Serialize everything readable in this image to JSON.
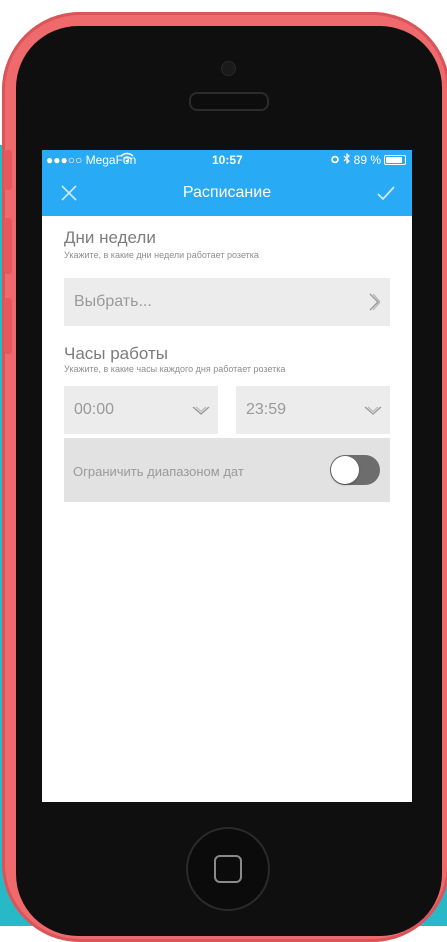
{
  "status_bar": {
    "carrier": "●●●○○ MegaFon",
    "time": "10:57",
    "battery": "89 %",
    "battery_level": 0.89,
    "icons": [
      "wifi-icon",
      "alarm-icon",
      "bluetooth-icon",
      "battery-icon"
    ]
  },
  "nav": {
    "title": "Расписание",
    "close_icon": "close-icon",
    "done_icon": "checkmark-icon"
  },
  "days_section": {
    "title": "Дни недели",
    "subtitle": "Укажите, в какие дни недели работает розетка",
    "select_placeholder": "Выбрать..."
  },
  "hours_section": {
    "title": "Часы работы",
    "subtitle": "Укажите, в какие часы каждого дня работает розетка",
    "start_time": "00:00",
    "end_time": "23:59"
  },
  "date_limit": {
    "label": "Ограничить диапазоном дат",
    "enabled": false
  },
  "colors": {
    "accent": "#29aaf4",
    "phone_body": "#ef6a6d",
    "background": "#27b9c6",
    "field": "#ececec",
    "toggle_off": "#6d6d6d"
  }
}
